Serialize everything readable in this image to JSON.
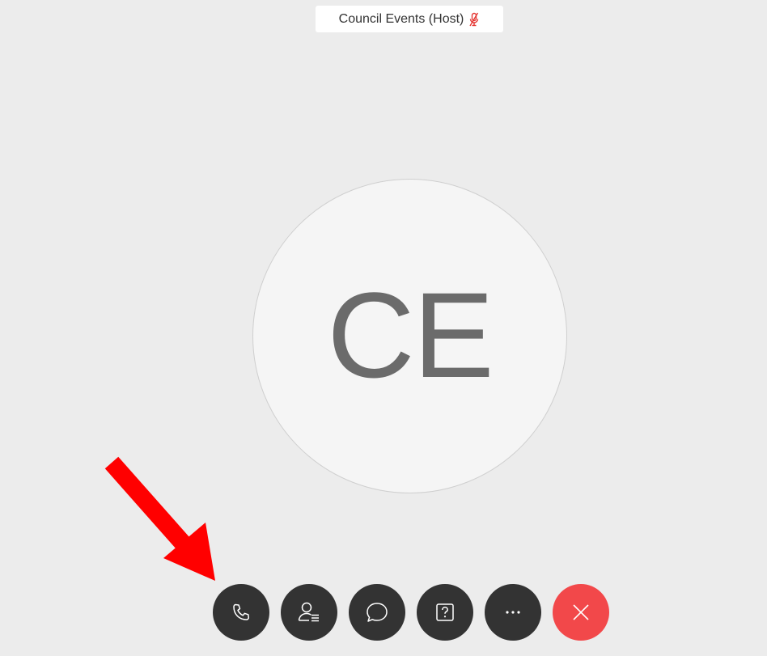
{
  "header": {
    "title": "Council Events (Host)",
    "status_icon": "muted-microphone-icon"
  },
  "participant": {
    "initials": "CE"
  },
  "toolbar": {
    "buttons": [
      {
        "name": "audio-button",
        "icon": "phone-icon"
      },
      {
        "name": "participants-button",
        "icon": "participants-list-icon"
      },
      {
        "name": "chat-button",
        "icon": "chat-bubble-icon"
      },
      {
        "name": "qa-button",
        "icon": "question-icon"
      },
      {
        "name": "more-button",
        "icon": "ellipsis-icon",
        "label": "···"
      },
      {
        "name": "end-meeting-button",
        "icon": "close-x-icon"
      }
    ]
  },
  "annotation": {
    "icon": "red-arrow-icon",
    "color": "#ff0000"
  },
  "colors": {
    "background": "#ececec",
    "button": "#333333",
    "end_button": "#f2484a",
    "muted_icon": "#e53935"
  }
}
